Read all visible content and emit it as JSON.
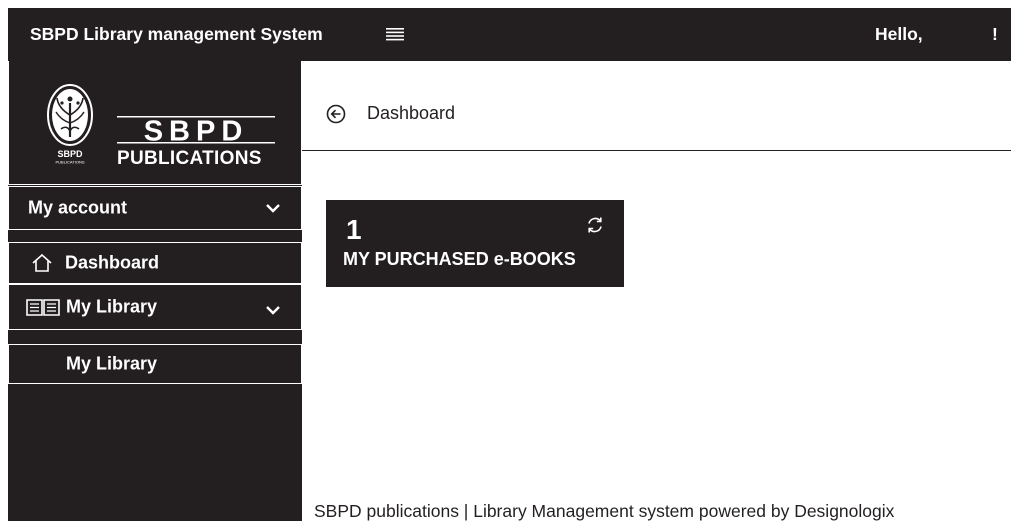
{
  "header": {
    "app_title": "SBPD Library management System",
    "greeting": "Hello,",
    "exclamation": "!"
  },
  "brand": {
    "wordmark": "SBPD",
    "tagline": "PUBLICATIONS",
    "emblem_small_text": "SBPD",
    "emblem_tiny_text": "PUBLICATIONS"
  },
  "sidebar": {
    "items": [
      {
        "label": "My account",
        "icon": "chevron-down-icon"
      },
      {
        "label": "Dashboard",
        "icon": "home-icon"
      },
      {
        "label": "My Library",
        "icon": "book-open-icon"
      },
      {
        "label": "My Library"
      }
    ]
  },
  "main": {
    "breadcrumb": "Dashboard",
    "card": {
      "count": "1",
      "label": "MY PURCHASED e-BOOKS",
      "icon": "refresh-icon"
    }
  },
  "footer": {
    "text": "SBPD publications | Library Management system powered by Designologix"
  },
  "colors": {
    "dark": "#231f20",
    "light": "#ffffff"
  }
}
